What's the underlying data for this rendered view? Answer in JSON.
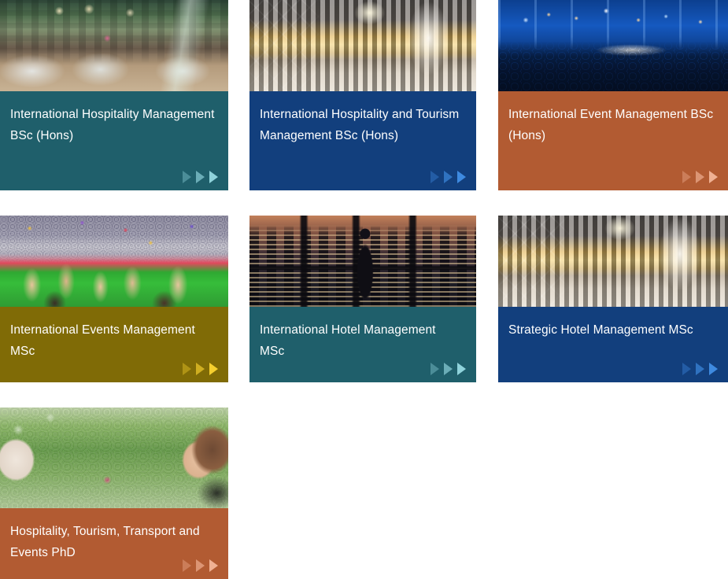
{
  "page": {
    "title": "Course cards grid",
    "background": "#ffffff",
    "columns": 3
  },
  "icons": {
    "arrow": "play-arrow-icon"
  },
  "cards": [
    {
      "id": "international-hospitality-management-bsc-hons",
      "title": "International Hospitality Management BSc (Hons)",
      "bg_color": "#1f5f6b",
      "arrow_color": "#8fd3db",
      "image": "restaurant-interior-photo",
      "image_alt": "Restaurant dining room with set tables and flowers",
      "arrows": 3
    },
    {
      "id": "international-hospitality-and-tourism-management-bsc-hons",
      "title": "International Hospitality and Tourism Management BSc (Hons)",
      "bg_color": "#123f7d",
      "arrow_color": "#3e8ae0",
      "image": "hotel-lobby-photo",
      "image_alt": "Luxury hotel lobby with illuminated gold reception desk",
      "arrows": 3
    },
    {
      "id": "international-event-management-bsc-hons",
      "title": "International Event Management BSc (Hons)",
      "bg_color": "#b25b32",
      "arrow_color": "#f0b193",
      "image": "concert-crowd-photo",
      "image_alt": "Blue-lit concert crowd at a live event",
      "arrows": 3
    },
    {
      "id": "international-events-management-msc",
      "title": "International Events Management MSc",
      "bg_color": "#806b06",
      "arrow_color": "#f5cf2e",
      "image": "stadium-celebration-photo",
      "image_alt": "Crowd celebrating with raised hands in a stadium with confetti",
      "arrows": 3
    },
    {
      "id": "international-hotel-management-msc",
      "title": "International Hotel Management MSc",
      "bg_color": "#1f5f6b",
      "arrow_color": "#8fd3db",
      "image": "city-skyline-photo",
      "image_alt": "Silhouette of a traveller with luggage against a night city skyline",
      "arrows": 3
    },
    {
      "id": "strategic-hotel-management-msc",
      "title": "Strategic Hotel Management MSc",
      "bg_color": "#123f7d",
      "arrow_color": "#3e8ae0",
      "image": "hotel-lobby-photo",
      "image_alt": "Luxury hotel lobby with illuminated gold reception desk",
      "arrows": 3
    },
    {
      "id": "hospitality-tourism-transport-and-events-phd",
      "title": "Hospitality, Tourism, Transport and Events PhD",
      "bg_color": "#b25b32",
      "arrow_color": "#f0b193",
      "image": "robot-garden-photo",
      "image_alt": "Humanoid robot facing a woman in a green garden setting",
      "arrows": 3
    }
  ]
}
